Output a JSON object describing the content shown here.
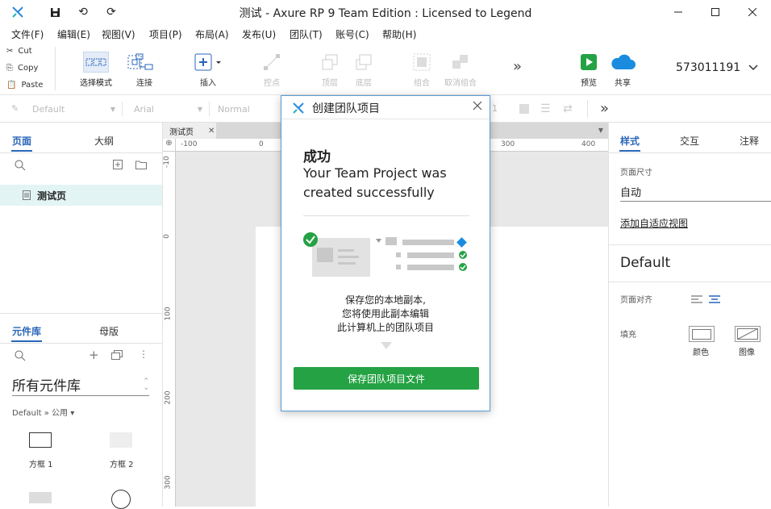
{
  "titlebar": {
    "title": "测试 - Axure RP 9 Team Edition : Licensed to Legend"
  },
  "menu": [
    {
      "label": "文件(F)"
    },
    {
      "label": "编辑(E)"
    },
    {
      "label": "视图(V)"
    },
    {
      "label": "项目(P)"
    },
    {
      "label": "布局(A)"
    },
    {
      "label": "发布(U)"
    },
    {
      "label": "团队(T)"
    },
    {
      "label": "账号(C)"
    },
    {
      "label": "帮助(H)"
    }
  ],
  "clipboard": {
    "cut": "Cut",
    "copy": "Copy",
    "paste": "Paste"
  },
  "tools": {
    "select_mode": "选择模式",
    "connect": "连接",
    "insert": "插入",
    "point": "控点",
    "top": "顶层",
    "bottom": "底层",
    "group": "组合",
    "ungroup": "取消组合",
    "more": "»",
    "preview": "预览",
    "share": "共享",
    "account": "573011191"
  },
  "stylebar": {
    "style": "Default",
    "font": "Arial",
    "weight": "Normal",
    "size_fragment": "1"
  },
  "pages_panel": {
    "tab_pages": "页面",
    "tab_outline": "大纲",
    "page_item": "测试页"
  },
  "library_panel": {
    "tab_libraries": "元件库",
    "tab_masters": "母版",
    "dropdown": "所有元件库",
    "breadcrumb": "Default » 公用 ▾",
    "widgets": [
      {
        "label": "方框 1"
      },
      {
        "label": "方框 2"
      }
    ]
  },
  "canvas": {
    "tab_label": "测试页",
    "ruler_h": [
      "-100",
      "0",
      "300",
      "400"
    ],
    "ruler_v": [
      "-10",
      "0",
      "100",
      "200",
      "300"
    ]
  },
  "right_panel": {
    "tab_style": "样式",
    "tab_interact": "交互",
    "tab_notes": "注释",
    "page_size_label": "页面尺寸",
    "page_size_value": "自动",
    "adaptive_link": "添加自适应视图",
    "style_name": "Default",
    "align_label": "页面对齐",
    "fill_label": "填充",
    "fill_color": "颜色",
    "fill_image": "图像"
  },
  "dialog": {
    "title": "创建团队项目",
    "success": "成功",
    "message": "Your Team Project was created successfully",
    "desc_line1": "保存您的本地副本,",
    "desc_line2": "您将使用此副本编辑",
    "desc_line3": "此计算机上的团队项目",
    "button": "保存团队项目文件"
  },
  "colors": {
    "accent_blue": "#2a66b8",
    "green": "#25a244",
    "share_blue": "#1a8ce0"
  }
}
